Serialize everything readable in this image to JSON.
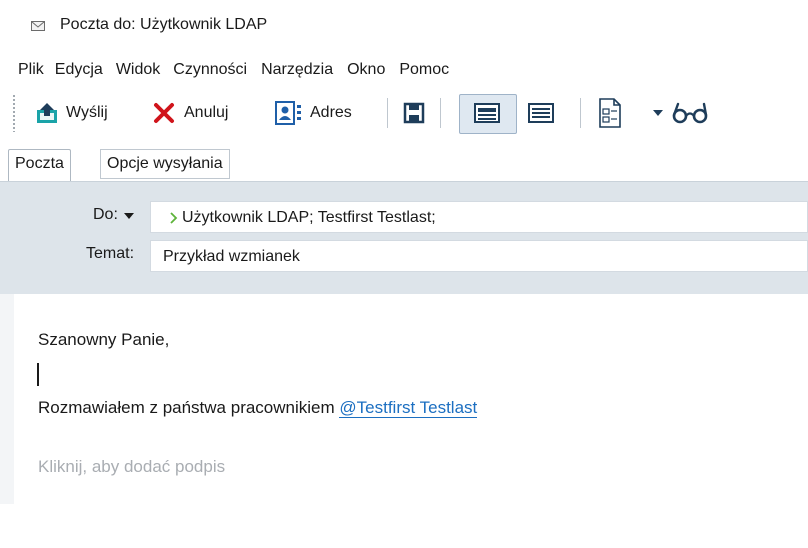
{
  "window": {
    "title": "Poczta do: Użytkownik LDAP"
  },
  "menu": {
    "items": [
      "Plik",
      "Edycja",
      "Widok",
      "Czynności",
      "Narzędzia",
      "Okno",
      "Pomoc"
    ]
  },
  "toolbar": {
    "send_label": "Wyślij",
    "cancel_label": "Anuluj",
    "address_label": "Adres",
    "icons": [
      "send-icon",
      "cancel-x-icon",
      "address-book-icon",
      "save-icon",
      "html-format-icon",
      "plain-text-icon",
      "template-icon",
      "dropdown-arrow-icon",
      "spectacles-icon"
    ]
  },
  "tabs": {
    "mail": "Poczta",
    "send_options": "Opcje wysyłania"
  },
  "header": {
    "to_label": "Do:",
    "to_value": "Użytkownik LDAP;  Testfirst Testlast;",
    "subject_label": "Temat:",
    "subject_value": "Przykład wzmianek"
  },
  "body": {
    "greeting": "Szanowny Panie,",
    "line_prefix": "Rozmawiałem z państwa pracownikiem ",
    "mention": "@Testfirst  Testlast",
    "signature_placeholder": "Kliknij, aby dodać podpis"
  },
  "colors": {
    "header_bg": "#dde4ea",
    "accent_send": "#1aa3a8",
    "cancel_red": "#d0141b",
    "address_blue": "#1f5fa8",
    "mention_blue": "#1c6fc1",
    "recipient_chevron": "#5db33a"
  }
}
